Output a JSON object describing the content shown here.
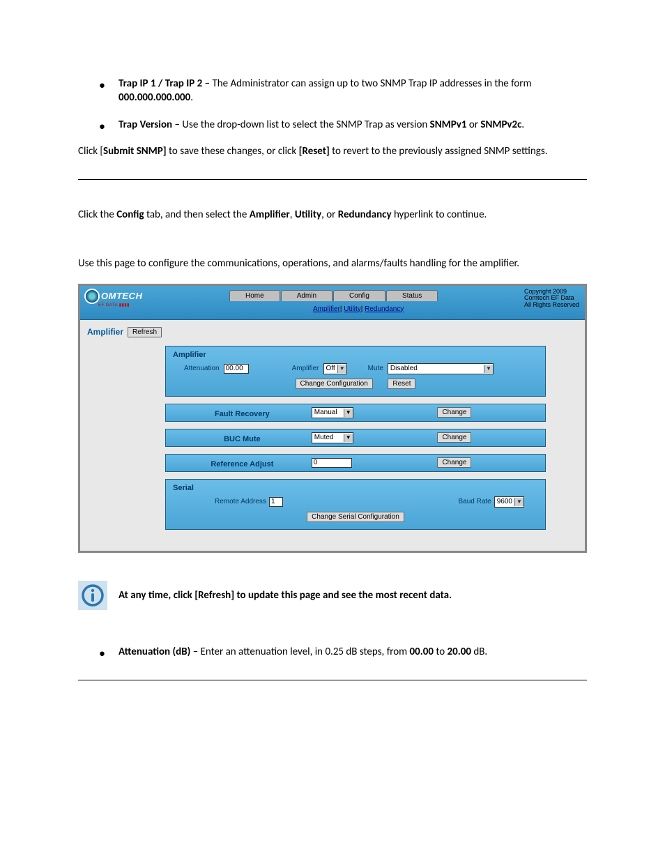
{
  "bullets_top": [
    {
      "term": "Trap IP 1 / Trap IP 2",
      "rest1": " – The Administrator can assign up to two SNMP Trap IP addresses in the form ",
      "bold2": "000.000.000.000",
      "tail": "."
    },
    {
      "term": "Trap Version",
      "rest1": " – Use the drop-down list to select the SNMP Trap as version ",
      "bold2": "SNMPv1",
      "rest2": " or ",
      "bold3": "SNMPv2c",
      "tail": "."
    }
  ],
  "line_click1": "Click [",
  "line_click_bold1": "Submit SNMP]",
  "line_click2": " to save these changes, or click ",
  "line_click_bold2": "[Reset]",
  "line_click3": " to revert to the previously assigned SNMP settings.",
  "config_line_1": "Click the ",
  "config_bold": "Config",
  "config_line_2": " tab, and then select the ",
  "amp_bold": "Amplifier",
  "config_line_3": ", ",
  "util_bold": "Utility",
  "config_line_4": ", or ",
  "red_bold": "Redundancy",
  "config_line_5": " hyperlink to continue.",
  "intro_p": "Use this page to configure the communications, operations, and alarms/faults handling for the amplifier.",
  "figure": {
    "logo_text": "OMTECH",
    "logo_sub": "EF DATA ▮▮▮▮",
    "copyright": "Copyright 2009\nComtech EF Data\nAll Rights Reserved",
    "tabs": [
      "Home",
      "Admin",
      "Config",
      "Status"
    ],
    "subtabs": [
      "Amplifier",
      "Utility",
      "Redundancy"
    ],
    "amp_title": "Amplifier",
    "refresh": "Refresh",
    "panel_amplifier": {
      "title": "Amplifier",
      "attenuation_label": "Attenuation",
      "attenuation_value": "00.00",
      "amplifier_label": "Amplifier",
      "amplifier_value": "Off",
      "mute_label": "Mute",
      "mute_value": "Disabled",
      "btn_change": "Change Configuration",
      "btn_reset": "Reset"
    },
    "panel_fault": {
      "title": "Fault Recovery",
      "value": "Manual",
      "btn": "Change"
    },
    "panel_buc": {
      "title": "BUC Mute",
      "value": "Muted",
      "btn": "Change"
    },
    "panel_ref": {
      "title": "Reference Adjust",
      "value": "0",
      "btn": "Change"
    },
    "panel_serial": {
      "title": "Serial",
      "remote_label": "Remote Address",
      "remote_value": "1",
      "baud_label": "Baud Rate",
      "baud_value": "9600",
      "btn": "Change Serial Configuration"
    }
  },
  "note_text": "At any time, click [Refresh] to update this page and see the most recent data.",
  "bullet_bottom": {
    "term": "Attenuation (dB)",
    "rest1": " – Enter an attenuation level, in 0.25 dB steps, from ",
    "bold2": "00.00",
    "rest2": " to ",
    "bold3": "20.00",
    "tail": " dB."
  }
}
